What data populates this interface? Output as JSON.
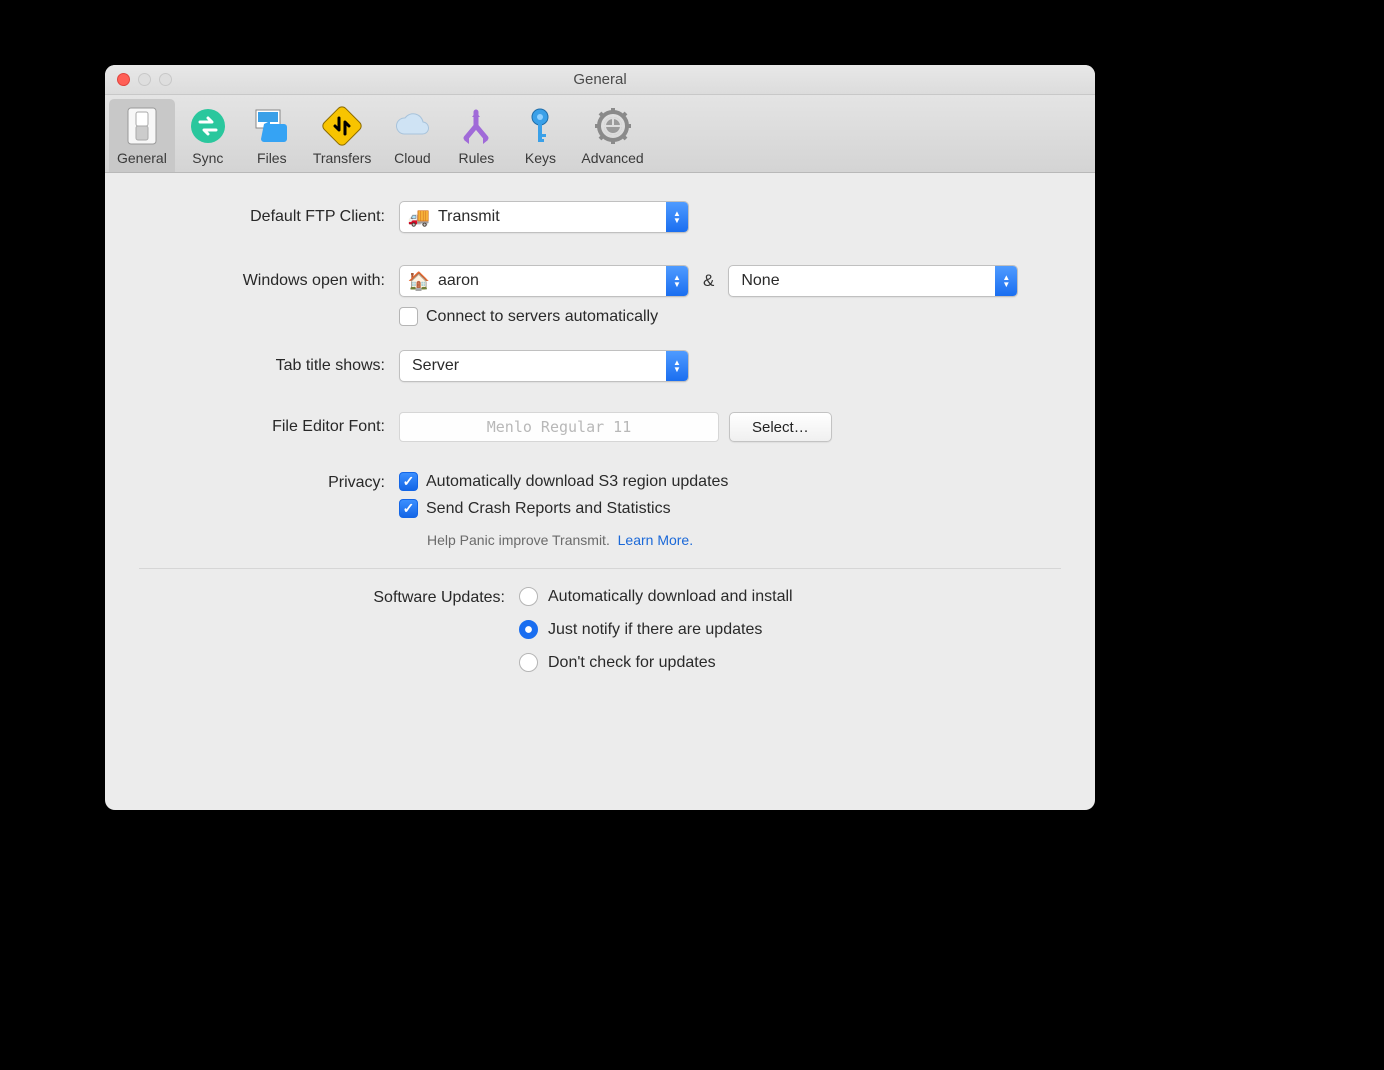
{
  "window": {
    "title": "General"
  },
  "toolbar": {
    "items": [
      {
        "label": "General"
      },
      {
        "label": "Sync"
      },
      {
        "label": "Files"
      },
      {
        "label": "Transfers"
      },
      {
        "label": "Cloud"
      },
      {
        "label": "Rules"
      },
      {
        "label": "Keys"
      },
      {
        "label": "Advanced"
      }
    ]
  },
  "form": {
    "ftp_client_label": "Default FTP Client:",
    "ftp_client_value": "Transmit",
    "windows_open_label": "Windows open with:",
    "windows_open_value": "aaron",
    "windows_open_amp": "&",
    "windows_open_value2": "None",
    "connect_auto_label": "Connect to servers automatically",
    "tab_title_label": "Tab title shows:",
    "tab_title_value": "Server",
    "font_label": "File Editor Font:",
    "font_value": "Menlo Regular 11",
    "select_button": "Select…",
    "privacy_label": "Privacy:",
    "privacy_opt1": "Automatically download S3 region updates",
    "privacy_opt2": "Send Crash Reports and Statistics",
    "privacy_help": "Help Panic improve Transmit.",
    "privacy_learn": "Learn More.",
    "updates_label": "Software Updates:",
    "updates_opt1": "Automatically download and install",
    "updates_opt2": "Just notify if there are updates",
    "updates_opt3": "Don't check for updates"
  }
}
